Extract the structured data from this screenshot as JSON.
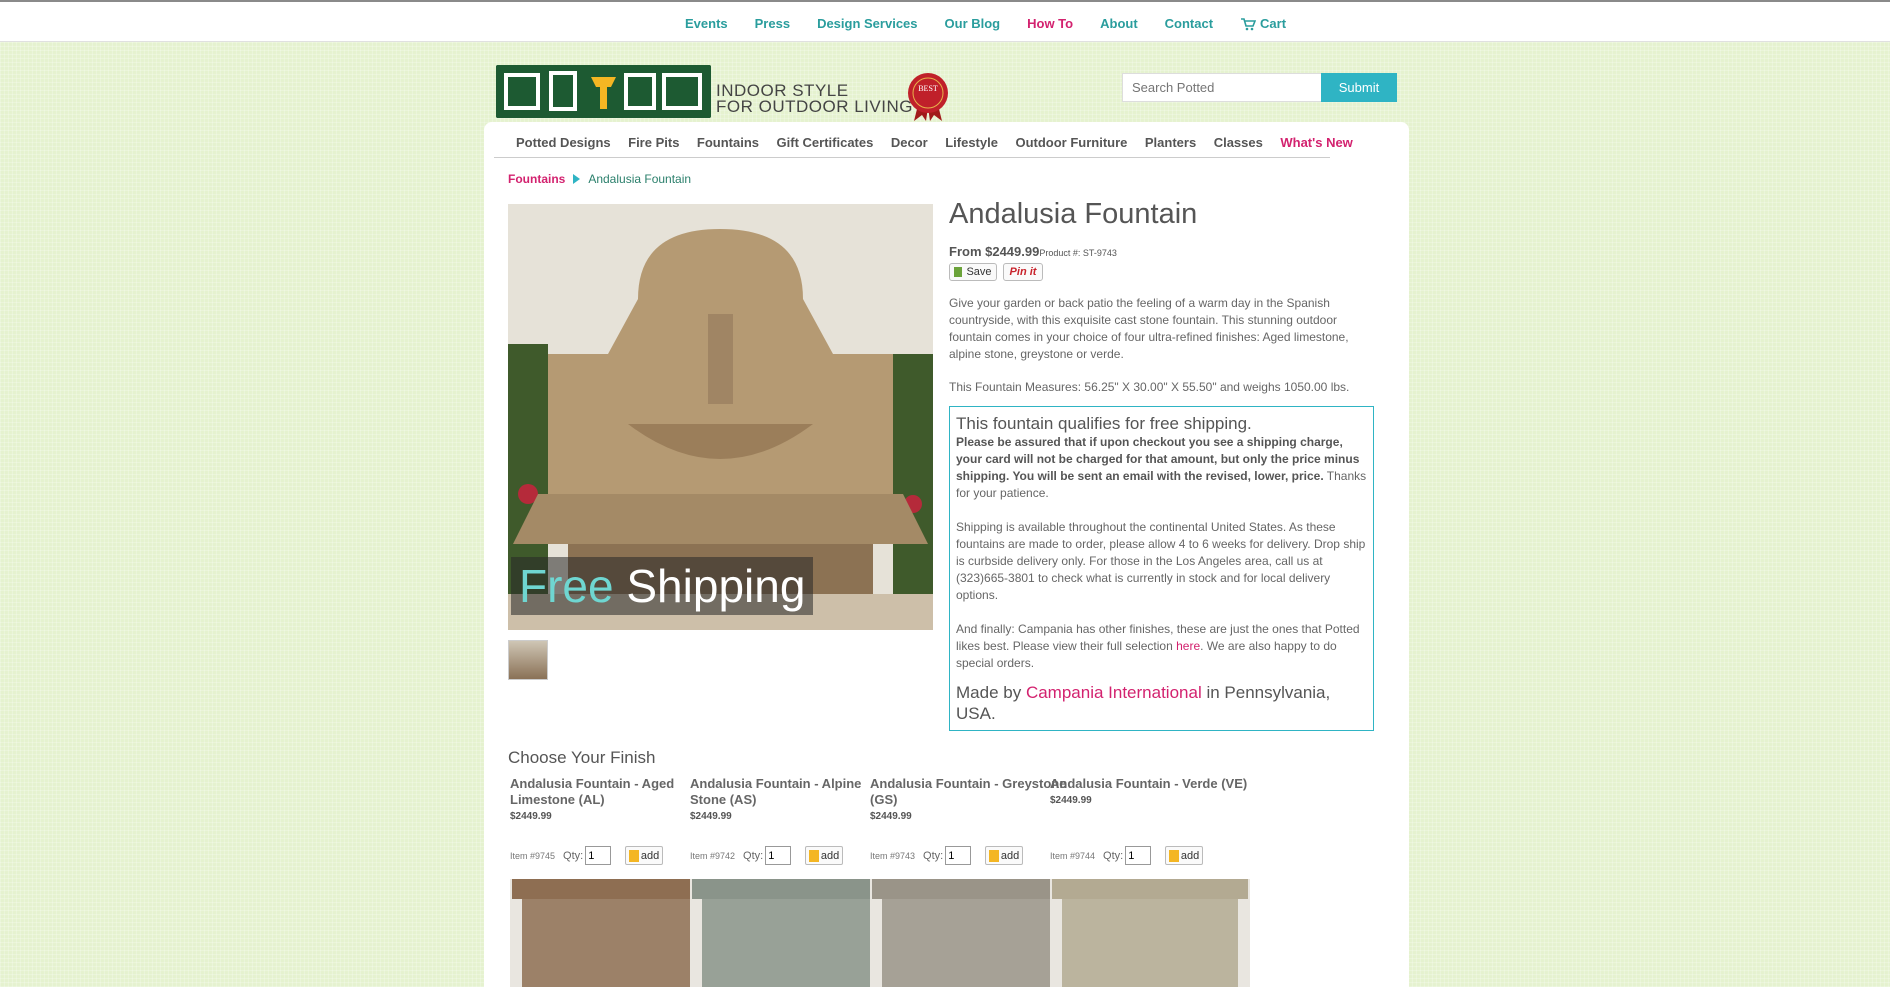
{
  "topnav": {
    "items": [
      "Events",
      "Press",
      "Design Services",
      "Our Blog",
      "How To",
      "About",
      "Contact"
    ],
    "cart_label": "Cart"
  },
  "logo": {
    "line1": "INDOOR STYLE",
    "line2": "FOR OUTDOOR LIVING",
    "seal_text": "BEST"
  },
  "search": {
    "placeholder": "Search Potted",
    "submit_label": "Submit"
  },
  "mainnav": {
    "items": [
      "Potted Designs",
      "Fire Pits",
      "Fountains",
      "Gift Certificates",
      "Decor",
      "Lifestyle",
      "Outdoor Furniture",
      "Planters",
      "Classes"
    ],
    "whats_new": "What's New"
  },
  "breadcrumb": {
    "parent": "Fountains",
    "current": "Andalusia Fountain"
  },
  "hero": {
    "free": "Free",
    "shipping": "Shipping"
  },
  "product": {
    "title": "Andalusia Fountain",
    "price": "From $2449.99",
    "product_number": "Product #:  ST-9743",
    "save_label": "Save",
    "pin_label": "Pin it",
    "description": "Give your garden or back patio the feeling of a warm day in the Spanish countryside, with this exquisite cast stone fountain. This stunning outdoor fountain comes in your choice of four ultra-refined finishes: Aged limestone, alpine stone, greystone or verde.",
    "measures": "This Fountain Measures: 56.25\" X 30.00\" X 55.50\" and weighs 1050.00 lbs."
  },
  "shipbox": {
    "heading": "This fountain qualifies for free shipping.",
    "bold_text": "Please be assured that if upon checkout you see a shipping charge, your card will not be charged for that amount, but only the price minus shipping. You will be sent an email with the revised, lower, price.",
    "thanks": " Thanks for your patience.",
    "shipping_info": "Shipping is available throughout the continental United States. As these fountains are made to order, please allow 4 to 6 weeks for delivery. Drop ship is curbside delivery only. For those in the Los Angeles area, call us at (323)665-3801 to check what is currently in stock and for local delivery options.",
    "finally_1": "And finally: Campania has other finishes, these are just the ones that Potted likes best. Please view their full selection ",
    "here_link": "here",
    "finally_2": ". We are also happy to do special orders.",
    "made_by": "Made by ",
    "maker_link": "Campania International",
    "made_in": " in Pennsylvania, USA."
  },
  "finishes": {
    "title": "Choose Your Finish",
    "qty_label": "Qty:",
    "add_label": "add",
    "items": [
      {
        "name": "Andalusia Fountain - Aged Limestone (AL)",
        "price": "$2449.99",
        "item": "Item #9745",
        "qty": "1",
        "color": "#8e6e52"
      },
      {
        "name": "Andalusia Fountain - Alpine Stone (AS)",
        "price": "$2449.99",
        "item": "Item #9742",
        "qty": "1",
        "color": "#8a948a"
      },
      {
        "name": "Andalusia Fountain - Greystone (GS)",
        "price": "$2449.99",
        "item": "Item #9743",
        "qty": "1",
        "color": "#9a9488"
      },
      {
        "name": "Andalusia Fountain - Verde (VE)",
        "price": "$2449.99",
        "item": "Item #9744",
        "qty": "1",
        "color": "#b3aa92"
      }
    ]
  }
}
